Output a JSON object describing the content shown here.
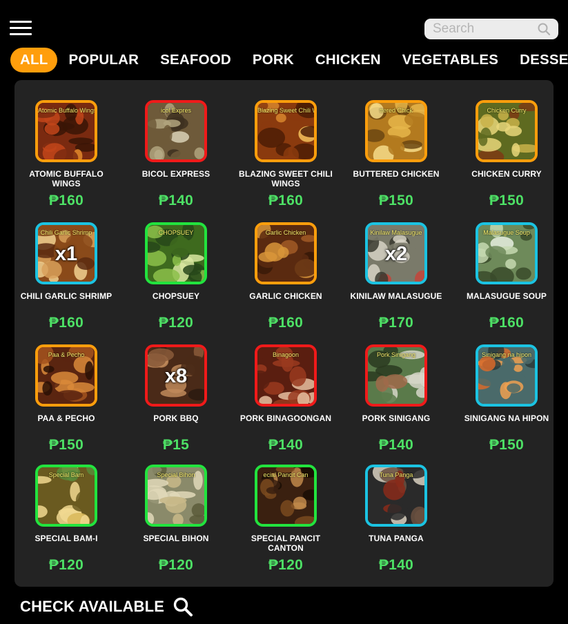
{
  "search": {
    "placeholder": "Search",
    "value": ""
  },
  "categories": [
    "ALL",
    "POPULAR",
    "SEAFOOD",
    "PORK",
    "CHICKEN",
    "VEGETABLES",
    "DESSERT"
  ],
  "active_category": "ALL",
  "colors": {
    "accent": "#ff9e0c",
    "price": "#4de065",
    "panel": "#232323",
    "border_orange": "#ff9e0c",
    "border_red": "#f01a1a",
    "border_blue": "#1bc3e2",
    "border_green": "#22e33e"
  },
  "items": [
    {
      "name": "ATOMIC BUFFALO WINGS",
      "price": "₱160",
      "caption": "Atomic Buffalo Wings",
      "border": "orange",
      "qty": ""
    },
    {
      "name": "BICOL EXPRESS",
      "price": "₱140",
      "caption": "icol Expres",
      "border": "red",
      "qty": ""
    },
    {
      "name": "BLAZING SWEET CHILI WINGS",
      "price": "₱160",
      "caption": "Blazing Sweet Chili Wings",
      "border": "orange",
      "qty": ""
    },
    {
      "name": "BUTTERED CHICKEN",
      "price": "₱150",
      "caption": "ttered Chick",
      "border": "orange",
      "qty": ""
    },
    {
      "name": "CHICKEN CURRY",
      "price": "₱150",
      "caption": "Chicken Curry",
      "border": "orange",
      "qty": ""
    },
    {
      "name": "CHILI GARLIC SHRIMP",
      "price": "₱160",
      "caption": "Chili Garlic Shrimp",
      "border": "blue",
      "qty": "x1"
    },
    {
      "name": "CHOPSUEY",
      "price": "₱120",
      "caption": "CHOPSUEY",
      "border": "green",
      "qty": ""
    },
    {
      "name": "GARLIC CHICKEN",
      "price": "₱160",
      "caption": "Garlic Chicken",
      "border": "orange",
      "qty": ""
    },
    {
      "name": "KINILAW MALASUGUE",
      "price": "₱170",
      "caption": "Kinilaw Malasugue",
      "border": "blue",
      "qty": "x2"
    },
    {
      "name": "MALASUGUE SOUP",
      "price": "₱160",
      "caption": "Malasugue Soup",
      "border": "blue",
      "qty": ""
    },
    {
      "name": "PAA & PECHO",
      "price": "₱150",
      "caption": "Paa & Pecho",
      "border": "orange",
      "qty": ""
    },
    {
      "name": "PORK BBQ",
      "price": "₱15",
      "caption": "",
      "border": "red",
      "qty": "x8"
    },
    {
      "name": "PORK BINAGOONGAN",
      "price": "₱140",
      "caption": "Binagoon",
      "border": "red",
      "qty": ""
    },
    {
      "name": "PORK SINIGANG",
      "price": "₱140",
      "caption": "Pork Sinigang",
      "border": "red",
      "qty": ""
    },
    {
      "name": "SINIGANG NA HIPON",
      "price": "₱150",
      "caption": "Sinigang na hipon",
      "border": "blue",
      "qty": ""
    },
    {
      "name": "SPECIAL BAM-I",
      "price": "₱120",
      "caption": "Special Bam",
      "border": "green",
      "qty": ""
    },
    {
      "name": "SPECIAL BIHON",
      "price": "₱120",
      "caption": "Special Bihon",
      "border": "green",
      "qty": ""
    },
    {
      "name": "SPECIAL PANCIT CANTON",
      "price": "₱120",
      "caption": "ecial Pancit Can",
      "border": "green",
      "qty": ""
    },
    {
      "name": "TUNA PANGA",
      "price": "₱140",
      "caption": "Tuna Panga",
      "border": "blue",
      "qty": ""
    }
  ],
  "footer": {
    "check_label": "CHECK AVAILABLE",
    "icon": "search-icon"
  }
}
